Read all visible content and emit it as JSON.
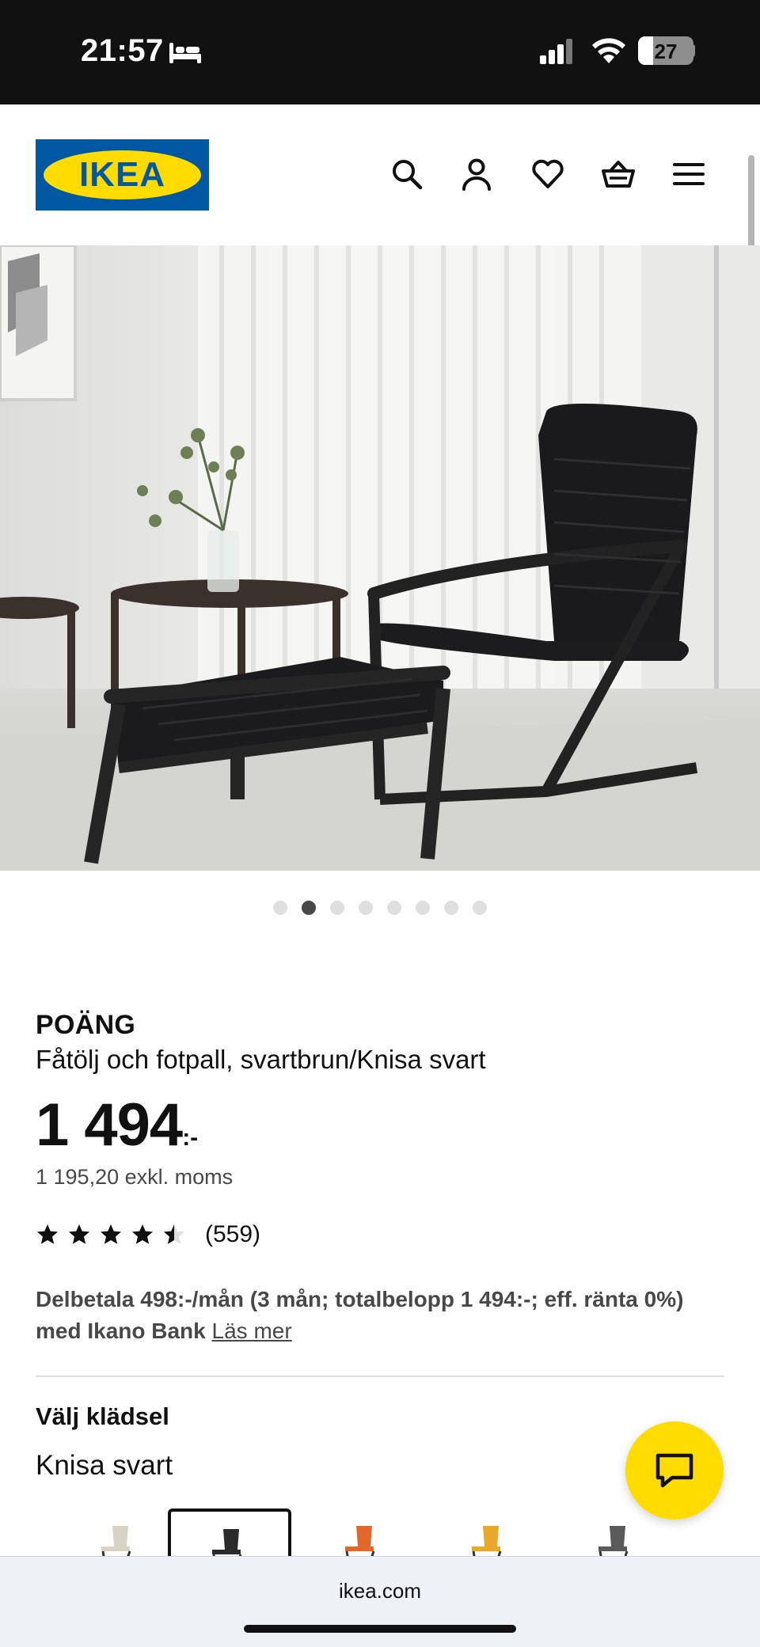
{
  "status_bar": {
    "time": "21:57",
    "battery": "27",
    "battery_level": 0.27,
    "icons": [
      "bed-icon",
      "signal-icon",
      "wifi-icon",
      "battery-icon"
    ]
  },
  "header": {
    "logo_text": "IKEA",
    "icons": [
      "search-icon",
      "account-icon",
      "heart-icon",
      "basket-icon",
      "menu-icon"
    ]
  },
  "carousel": {
    "total": 8,
    "active_index": 1
  },
  "product": {
    "name": "POÄNG",
    "description": "Fåtölj och fotpall, svartbrun/Knisa svart",
    "price": "1 494",
    "price_suffix": ":-",
    "price_ex_vat": "1 195,20 exkl. moms",
    "rating": 4.5,
    "rating_max": 5,
    "review_count": "(559)"
  },
  "financing": {
    "text": "Delbetala 498:-/mån (3 mån; totalbelopp 1 494:-; eff. ränta 0%) med Ikano Bank",
    "link": "Läs mer"
  },
  "fabric": {
    "title": "Välj klädsel",
    "selected": "Knisa svart",
    "swatches": [
      {
        "color": "#d8d2c4",
        "selected": false
      },
      {
        "color": "#2b2b2b",
        "selected": true
      },
      {
        "color": "#e2672a",
        "selected": false
      },
      {
        "color": "#e8a92a",
        "selected": false
      },
      {
        "color": "#5a5a5a",
        "selected": false
      }
    ]
  },
  "colors": {
    "ikea_blue": "#0058a3",
    "ikea_yellow": "#ffdb00",
    "text": "#111111",
    "muted": "#484848"
  },
  "browser": {
    "url": "ikea.com"
  }
}
